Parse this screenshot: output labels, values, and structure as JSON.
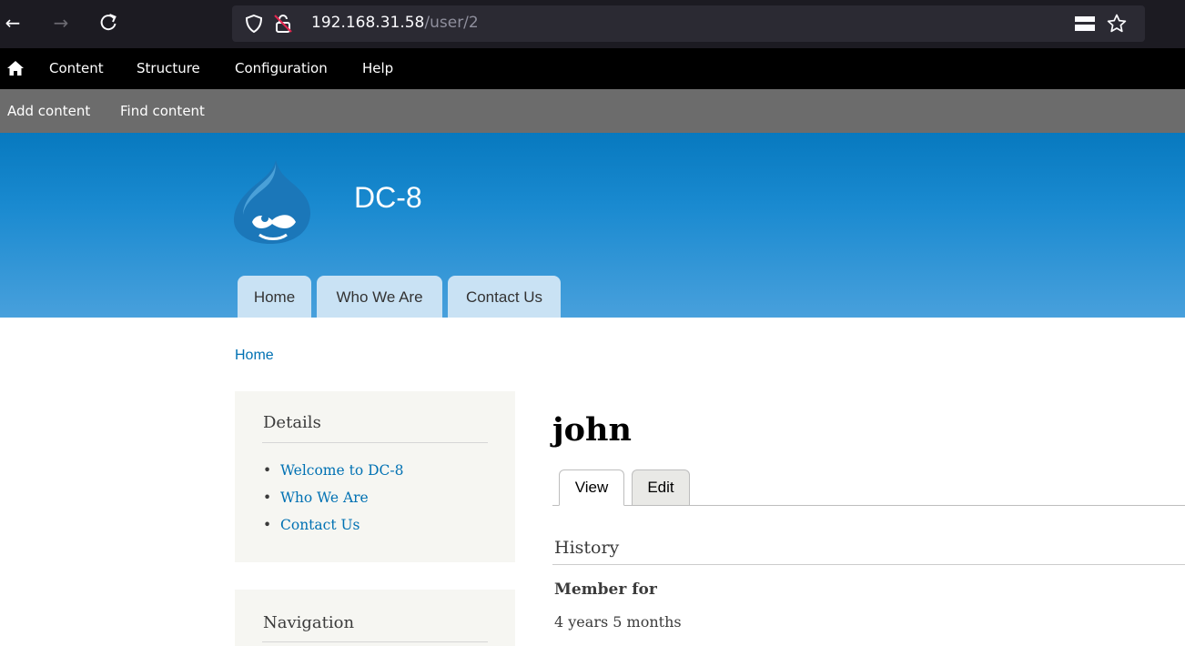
{
  "browser": {
    "back_glyph": "←",
    "forward_glyph": "→",
    "reload_glyph": "C",
    "url_host": "192.168.31.58",
    "url_path": "/user/2",
    "icons": [
      "back-arrow-icon",
      "forward-arrow-icon",
      "reload-icon",
      "shield-icon",
      "insecure-lock-icon",
      "reader-view-icon",
      "bookmark-star-icon"
    ]
  },
  "admin_toolbar": {
    "items": [
      "Content",
      "Structure",
      "Configuration",
      "Help"
    ],
    "tray_items": [
      "Add content",
      "Find content"
    ]
  },
  "header": {
    "site_name": "DC-8",
    "tabs": [
      "Home",
      "Who We Are",
      "Contact Us"
    ]
  },
  "breadcrumb": {
    "home": "Home"
  },
  "sidebar": {
    "details": {
      "title": "Details",
      "links": [
        "Welcome to DC-8",
        "Who We Are",
        "Contact Us"
      ]
    },
    "navigation": {
      "title": "Navigation"
    }
  },
  "main": {
    "title": "john",
    "tabs": [
      "View",
      "Edit"
    ],
    "history_heading": "History",
    "member_for_label": "Member for",
    "member_for_value": "4 years 5 months"
  },
  "colors": {
    "header_top": "#0779bf",
    "header_bottom": "#48a0dc",
    "link": "#0071b3",
    "sidebar_bg": "#f6f6f2",
    "admin_bar": "#000000",
    "admin_tray": "#6c6c6c"
  }
}
